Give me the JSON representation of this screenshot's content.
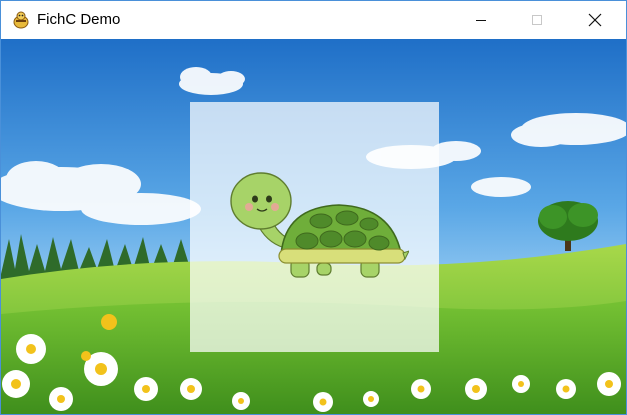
{
  "window": {
    "title": "FichC Demo",
    "controls": {
      "minimize": "minimize",
      "maximize": "maximize",
      "close": "close"
    }
  },
  "colors": {
    "sky_top": "#2d7fd3",
    "sky_bottom": "#bfe2ff",
    "grass_light": "#a8d84a",
    "grass_dark": "#4e9d22",
    "turtle_shell": "#6fae3a",
    "turtle_body": "#a7d368"
  },
  "icons": [
    "app-icon",
    "minimize-icon",
    "maximize-icon",
    "close-icon"
  ]
}
